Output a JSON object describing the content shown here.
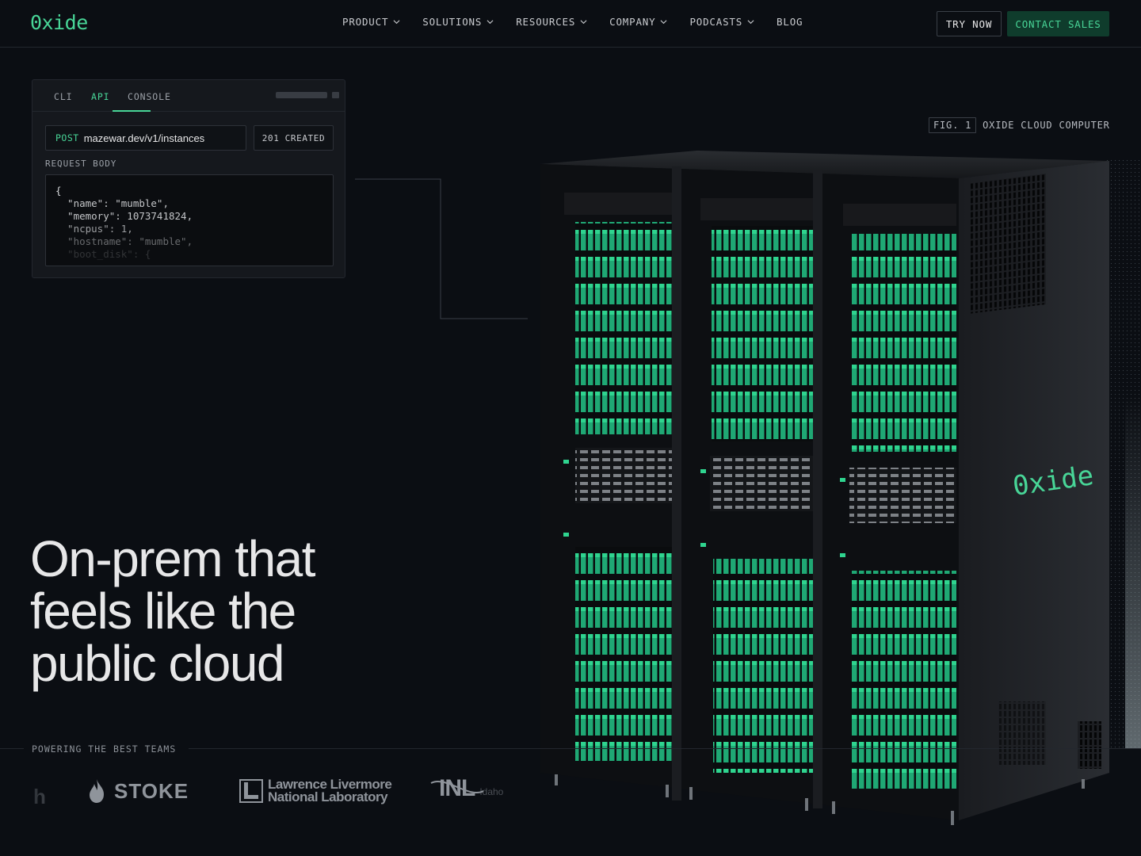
{
  "brand": {
    "logo_text": "0xide",
    "accent": "#48d597"
  },
  "nav": {
    "items": [
      {
        "label": "PRODUCT",
        "dropdown": true
      },
      {
        "label": "SOLUTIONS",
        "dropdown": true
      },
      {
        "label": "RESOURCES",
        "dropdown": true
      },
      {
        "label": "COMPANY",
        "dropdown": true
      },
      {
        "label": "PODCASTS",
        "dropdown": true
      },
      {
        "label": "BLOG",
        "dropdown": false
      }
    ],
    "try_now": "TRY NOW",
    "contact_sales": "CONTACT SALES"
  },
  "api_panel": {
    "tabs": [
      "CLI",
      "API",
      "CONSOLE"
    ],
    "active_tab": "API",
    "method": "POST",
    "url": "mazewar.dev/v1/instances",
    "status": "201 CREATED",
    "request_body_label": "REQUEST BODY",
    "code_lines": [
      "{",
      "  \"name\": \"mumble\",",
      "  \"memory\": 1073741824,",
      "  \"ncpus\": 1,",
      "  \"hostname\": \"mumble\",",
      "  \"boot_disk\": {"
    ]
  },
  "figure": {
    "fig_tag": "FIG. 1",
    "caption": "OXIDE CLOUD COMPUTER",
    "rack_brand": "0xide"
  },
  "hero": {
    "headline": "On-prem that feels like the public cloud"
  },
  "teams": {
    "label": "POWERING THE BEST TEAMS",
    "logos": [
      {
        "name": "partial-logo",
        "text": "h"
      },
      {
        "name": "stoke-logo",
        "text": "STOKE"
      },
      {
        "name": "llnl-logo",
        "text_line1": "Lawrence Livermore",
        "text_line2": "National Laboratory"
      },
      {
        "name": "inl-logo",
        "text": "INL",
        "sub": "Idaho"
      }
    ]
  }
}
